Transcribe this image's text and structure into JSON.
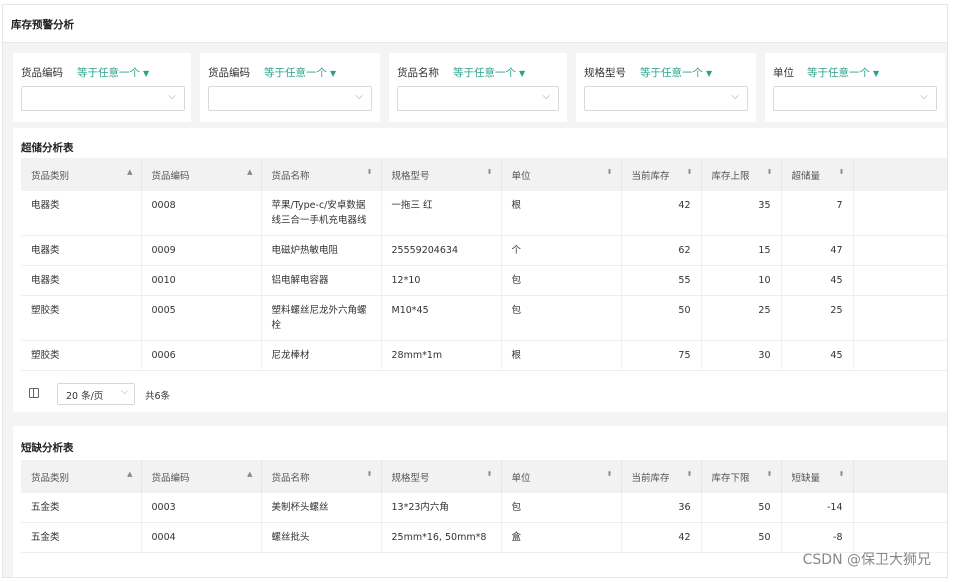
{
  "page": {
    "title": "库存预警分析"
  },
  "filters": [
    {
      "label": "货品编码",
      "operator": "等于任意一个",
      "value": ""
    },
    {
      "label": "货品编码",
      "operator": "等于任意一个",
      "value": ""
    },
    {
      "label": "货品名称",
      "operator": "等于任意一个",
      "value": ""
    },
    {
      "label": "规格型号",
      "operator": "等于任意一个",
      "value": ""
    },
    {
      "label": "单位",
      "operator": "等于任意一个",
      "value": ""
    }
  ],
  "overstock": {
    "title": "超储分析表",
    "columns": [
      "货品类别",
      "货品编码",
      "货品名称",
      "规格型号",
      "单位",
      "当前库存",
      "库存上限",
      "超储量"
    ],
    "rows": [
      [
        "电器类",
        "0008",
        "苹果/Type-c/安卓数据线三合一手机充电器线",
        "一拖三 红",
        "根",
        "42",
        "35",
        "7"
      ],
      [
        "电器类",
        "0009",
        "电磁炉热敏电阻",
        "25559204634",
        "个",
        "62",
        "15",
        "47"
      ],
      [
        "电器类",
        "0010",
        "铝电解电容器",
        "12*10",
        "包",
        "55",
        "10",
        "45"
      ],
      [
        "塑胶类",
        "0005",
        "塑料螺丝尼龙外六角螺栓",
        "M10*45",
        "包",
        "50",
        "25",
        "25"
      ],
      [
        "塑胶类",
        "0006",
        "尼龙棒材",
        "28mm*1m",
        "根",
        "75",
        "30",
        "45"
      ]
    ],
    "pager": {
      "page_size": "20 条/页",
      "total": "共6条"
    }
  },
  "shortage": {
    "title": "短缺分析表",
    "columns": [
      "货品类别",
      "货品编码",
      "货品名称",
      "规格型号",
      "单位",
      "当前库存",
      "库存下限",
      "短缺量"
    ],
    "rows": [
      [
        "五金类",
        "0003",
        "美制杯头螺丝",
        "13*23内六角",
        "包",
        "36",
        "50",
        "-14"
      ],
      [
        "五金类",
        "0004",
        "螺丝批头",
        "25mm*16, 50mm*8",
        "盒",
        "42",
        "50",
        "-8"
      ]
    ]
  },
  "watermark": "CSDN @保卫大狮兄",
  "colors": {
    "accent": "#2aa089",
    "header_bg": "#f2f2f2"
  }
}
